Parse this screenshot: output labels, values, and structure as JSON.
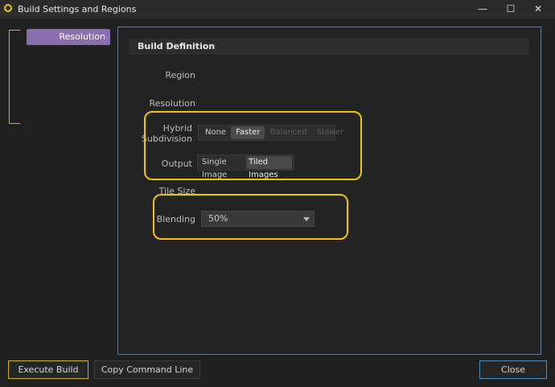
{
  "window": {
    "title": "Build Settings and Regions",
    "controls": {
      "minimize": "—",
      "maximize": "☐",
      "close": "✕"
    }
  },
  "sidebar": {
    "items": [
      {
        "label": "Resolution",
        "selected": true
      }
    ]
  },
  "section": {
    "title": "Build Definition",
    "region_label": "Region",
    "resolution_label": "Resolution",
    "hybrid_label_1": "Hybrid",
    "hybrid_label_2": "Subdivision",
    "hybrid_options": [
      {
        "label": "None"
      },
      {
        "label": "Faster",
        "selected": true
      },
      {
        "label": "Balanced",
        "disabled": true
      },
      {
        "label": "Slower",
        "disabled": true
      }
    ],
    "output_label": "Output",
    "output_options": [
      {
        "label": "Single Image"
      },
      {
        "label": "Tiled Images",
        "selected": true
      }
    ],
    "tile_size_label": "Tile Size",
    "blending_label": "Blending",
    "blending_value": "50%"
  },
  "footer": {
    "execute_label": "Execute Build",
    "copy_label": "Copy Command Line",
    "close_label": "Close"
  },
  "colors": {
    "highlight": "#f5c400",
    "sidebar_selected": "#8a6fae",
    "panel_border": "#5f7f93",
    "close_border": "#4e8fc4"
  }
}
